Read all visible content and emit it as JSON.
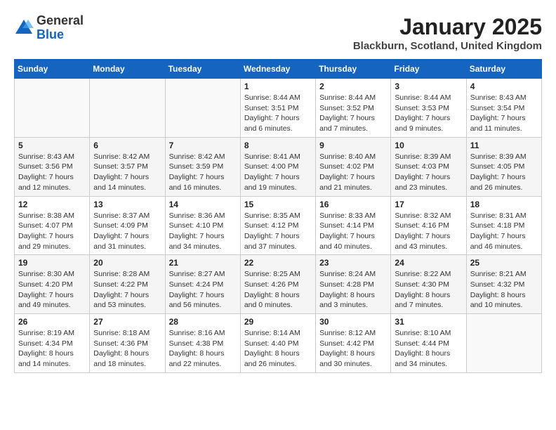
{
  "header": {
    "logo_general": "General",
    "logo_blue": "Blue",
    "month": "January 2025",
    "location": "Blackburn, Scotland, United Kingdom"
  },
  "weekdays": [
    "Sunday",
    "Monday",
    "Tuesday",
    "Wednesday",
    "Thursday",
    "Friday",
    "Saturday"
  ],
  "weeks": [
    [
      {
        "day": "",
        "info": ""
      },
      {
        "day": "",
        "info": ""
      },
      {
        "day": "",
        "info": ""
      },
      {
        "day": "1",
        "info": "Sunrise: 8:44 AM\nSunset: 3:51 PM\nDaylight: 7 hours and 6 minutes."
      },
      {
        "day": "2",
        "info": "Sunrise: 8:44 AM\nSunset: 3:52 PM\nDaylight: 7 hours and 7 minutes."
      },
      {
        "day": "3",
        "info": "Sunrise: 8:44 AM\nSunset: 3:53 PM\nDaylight: 7 hours and 9 minutes."
      },
      {
        "day": "4",
        "info": "Sunrise: 8:43 AM\nSunset: 3:54 PM\nDaylight: 7 hours and 11 minutes."
      }
    ],
    [
      {
        "day": "5",
        "info": "Sunrise: 8:43 AM\nSunset: 3:56 PM\nDaylight: 7 hours and 12 minutes."
      },
      {
        "day": "6",
        "info": "Sunrise: 8:42 AM\nSunset: 3:57 PM\nDaylight: 7 hours and 14 minutes."
      },
      {
        "day": "7",
        "info": "Sunrise: 8:42 AM\nSunset: 3:59 PM\nDaylight: 7 hours and 16 minutes."
      },
      {
        "day": "8",
        "info": "Sunrise: 8:41 AM\nSunset: 4:00 PM\nDaylight: 7 hours and 19 minutes."
      },
      {
        "day": "9",
        "info": "Sunrise: 8:40 AM\nSunset: 4:02 PM\nDaylight: 7 hours and 21 minutes."
      },
      {
        "day": "10",
        "info": "Sunrise: 8:39 AM\nSunset: 4:03 PM\nDaylight: 7 hours and 23 minutes."
      },
      {
        "day": "11",
        "info": "Sunrise: 8:39 AM\nSunset: 4:05 PM\nDaylight: 7 hours and 26 minutes."
      }
    ],
    [
      {
        "day": "12",
        "info": "Sunrise: 8:38 AM\nSunset: 4:07 PM\nDaylight: 7 hours and 29 minutes."
      },
      {
        "day": "13",
        "info": "Sunrise: 8:37 AM\nSunset: 4:09 PM\nDaylight: 7 hours and 31 minutes."
      },
      {
        "day": "14",
        "info": "Sunrise: 8:36 AM\nSunset: 4:10 PM\nDaylight: 7 hours and 34 minutes."
      },
      {
        "day": "15",
        "info": "Sunrise: 8:35 AM\nSunset: 4:12 PM\nDaylight: 7 hours and 37 minutes."
      },
      {
        "day": "16",
        "info": "Sunrise: 8:33 AM\nSunset: 4:14 PM\nDaylight: 7 hours and 40 minutes."
      },
      {
        "day": "17",
        "info": "Sunrise: 8:32 AM\nSunset: 4:16 PM\nDaylight: 7 hours and 43 minutes."
      },
      {
        "day": "18",
        "info": "Sunrise: 8:31 AM\nSunset: 4:18 PM\nDaylight: 7 hours and 46 minutes."
      }
    ],
    [
      {
        "day": "19",
        "info": "Sunrise: 8:30 AM\nSunset: 4:20 PM\nDaylight: 7 hours and 49 minutes."
      },
      {
        "day": "20",
        "info": "Sunrise: 8:28 AM\nSunset: 4:22 PM\nDaylight: 7 hours and 53 minutes."
      },
      {
        "day": "21",
        "info": "Sunrise: 8:27 AM\nSunset: 4:24 PM\nDaylight: 7 hours and 56 minutes."
      },
      {
        "day": "22",
        "info": "Sunrise: 8:25 AM\nSunset: 4:26 PM\nDaylight: 8 hours and 0 minutes."
      },
      {
        "day": "23",
        "info": "Sunrise: 8:24 AM\nSunset: 4:28 PM\nDaylight: 8 hours and 3 minutes."
      },
      {
        "day": "24",
        "info": "Sunrise: 8:22 AM\nSunset: 4:30 PM\nDaylight: 8 hours and 7 minutes."
      },
      {
        "day": "25",
        "info": "Sunrise: 8:21 AM\nSunset: 4:32 PM\nDaylight: 8 hours and 10 minutes."
      }
    ],
    [
      {
        "day": "26",
        "info": "Sunrise: 8:19 AM\nSunset: 4:34 PM\nDaylight: 8 hours and 14 minutes."
      },
      {
        "day": "27",
        "info": "Sunrise: 8:18 AM\nSunset: 4:36 PM\nDaylight: 8 hours and 18 minutes."
      },
      {
        "day": "28",
        "info": "Sunrise: 8:16 AM\nSunset: 4:38 PM\nDaylight: 8 hours and 22 minutes."
      },
      {
        "day": "29",
        "info": "Sunrise: 8:14 AM\nSunset: 4:40 PM\nDaylight: 8 hours and 26 minutes."
      },
      {
        "day": "30",
        "info": "Sunrise: 8:12 AM\nSunset: 4:42 PM\nDaylight: 8 hours and 30 minutes."
      },
      {
        "day": "31",
        "info": "Sunrise: 8:10 AM\nSunset: 4:44 PM\nDaylight: 8 hours and 34 minutes."
      },
      {
        "day": "",
        "info": ""
      }
    ]
  ]
}
